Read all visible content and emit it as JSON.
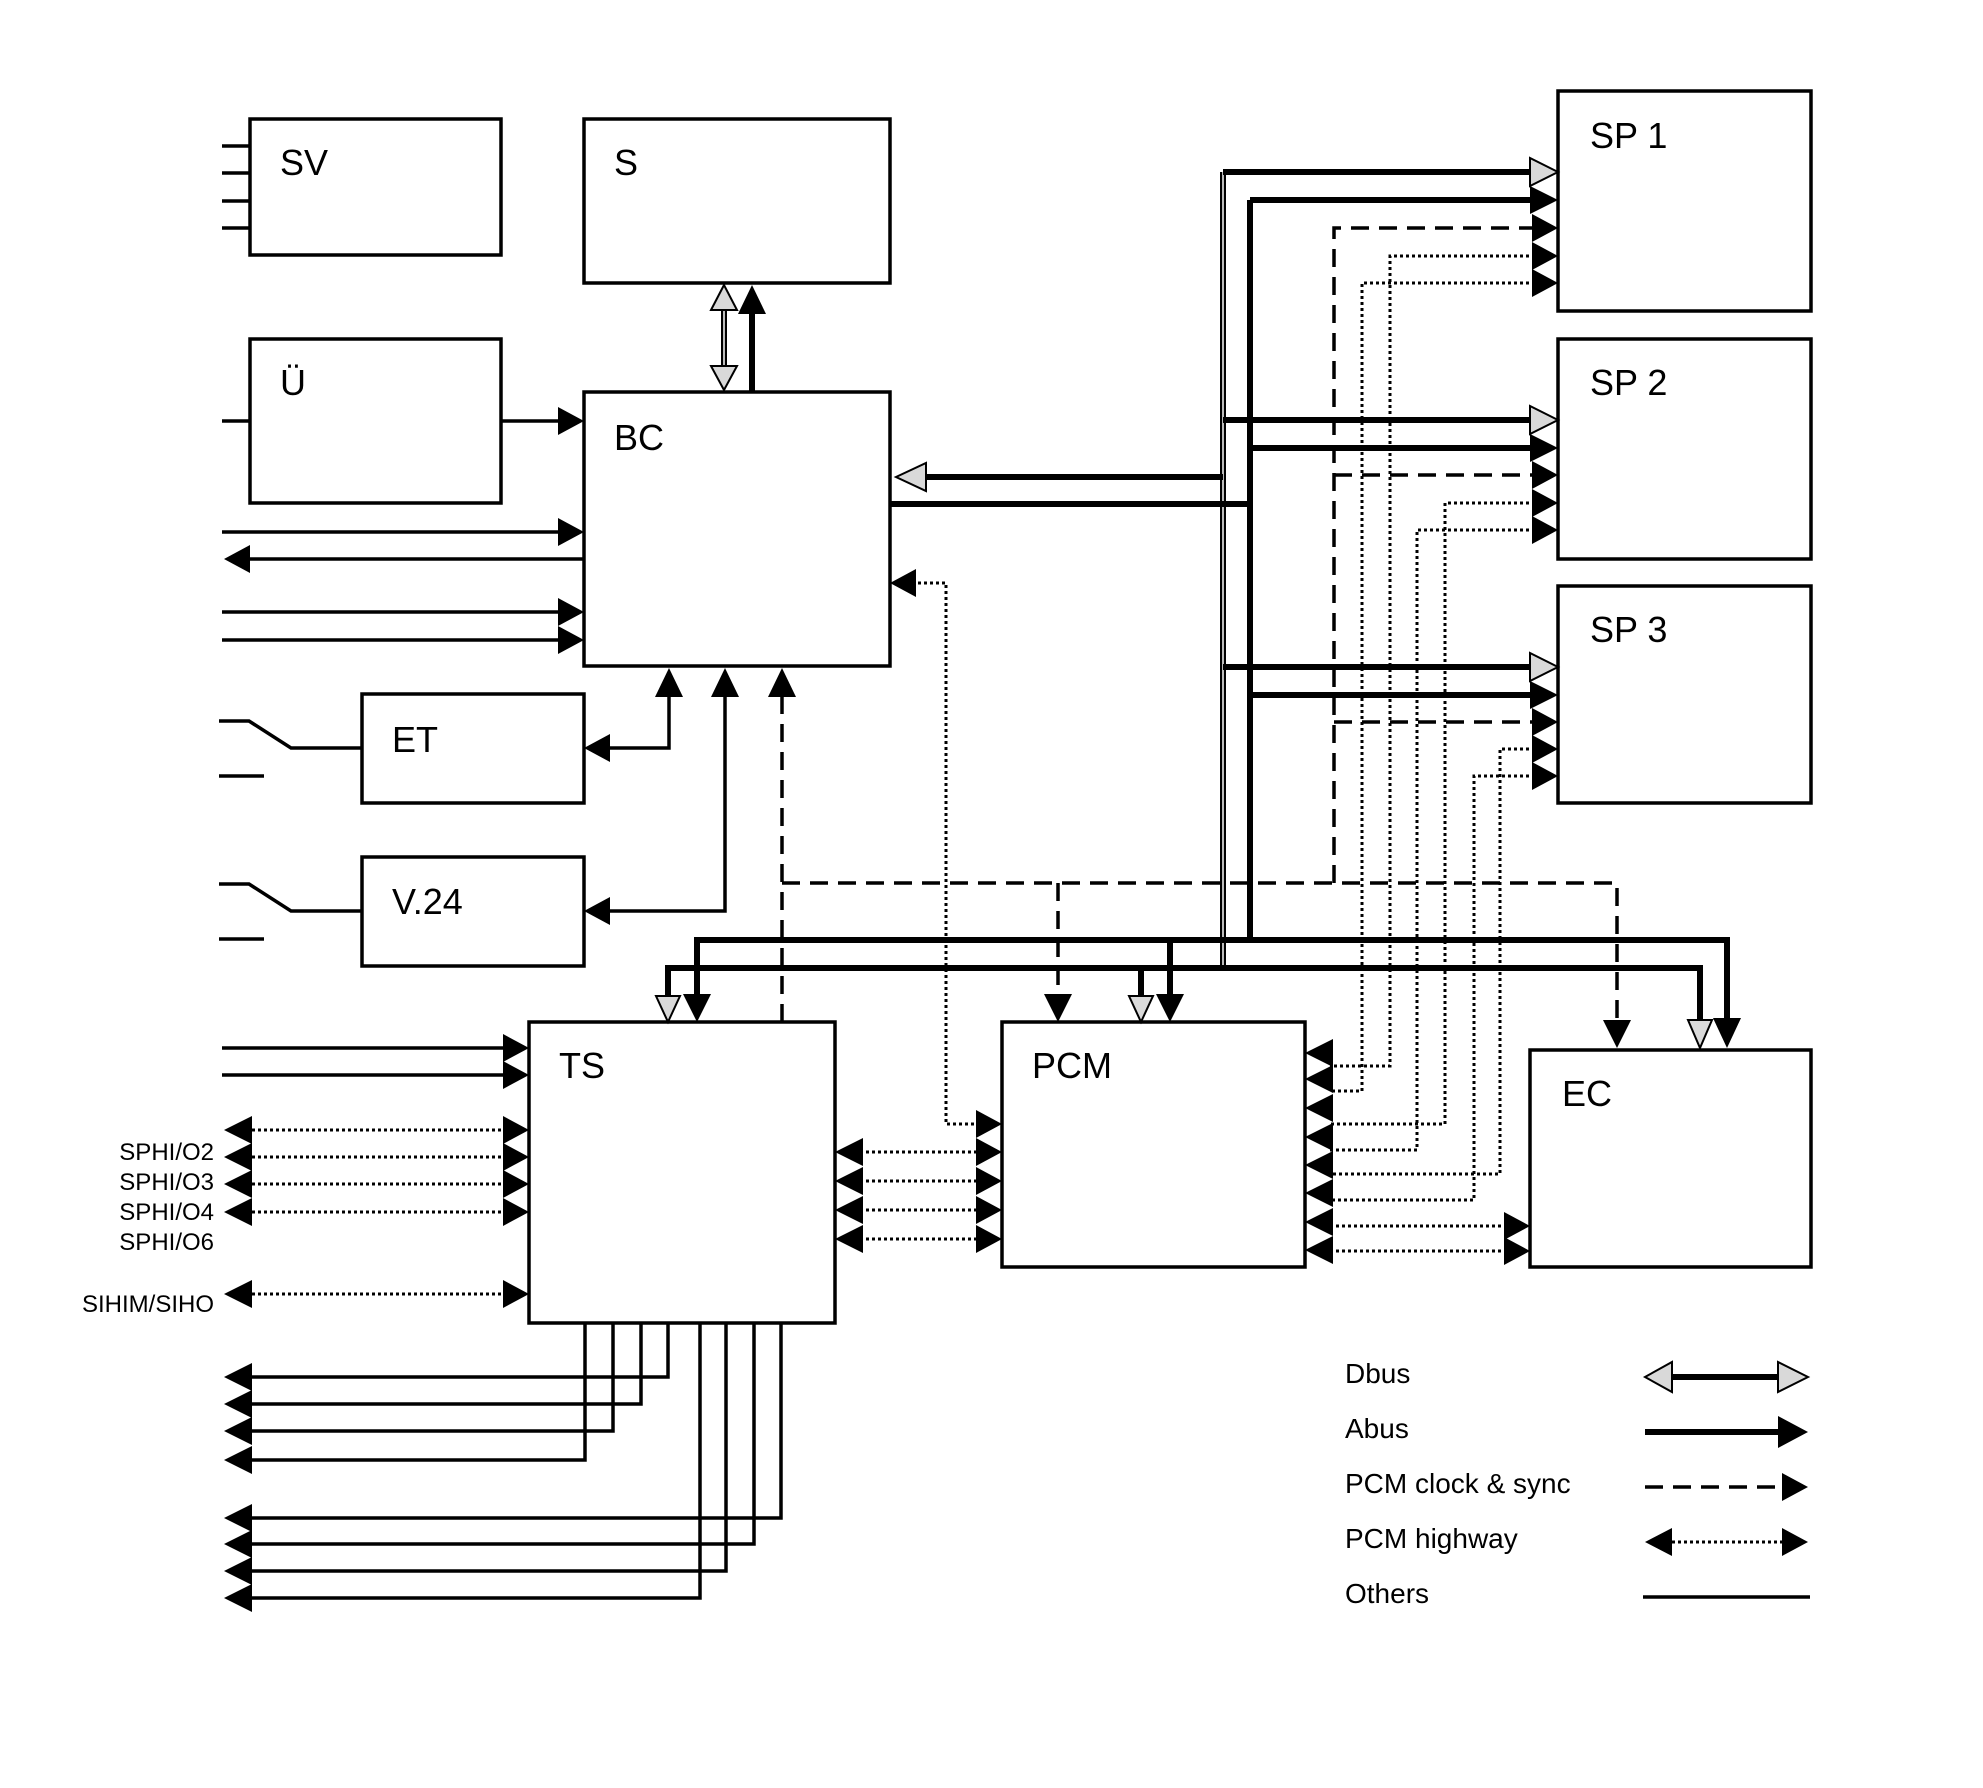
{
  "diagram": {
    "blocks": {
      "sv": "SV",
      "s": "S",
      "ue": "Ü",
      "bc": "BC",
      "et": "ET",
      "v24": "V.24",
      "ts": "TS",
      "pcm": "PCM",
      "ec": "EC",
      "sp1": "SP 1",
      "sp2": "SP 2",
      "sp3": "SP 3"
    },
    "side_labels": [
      "SPHI/O2",
      "SPHI/O3",
      "SPHI/O4",
      "SPHI/O6",
      "SIHIM/SIHO"
    ],
    "legend": [
      {
        "label": "Dbus",
        "style": "double-headed grey-arrow bus"
      },
      {
        "label": "Abus",
        "style": "thick solid arrow"
      },
      {
        "label": "PCM clock & sync",
        "style": "dashed arrow"
      },
      {
        "label": "PCM highway",
        "style": "dotted double-headed arrow"
      },
      {
        "label": "Others",
        "style": "plain solid line"
      }
    ],
    "colors": {
      "line": "#000000",
      "dbus_fill": "#d9d9d9",
      "background": "#ffffff"
    }
  }
}
